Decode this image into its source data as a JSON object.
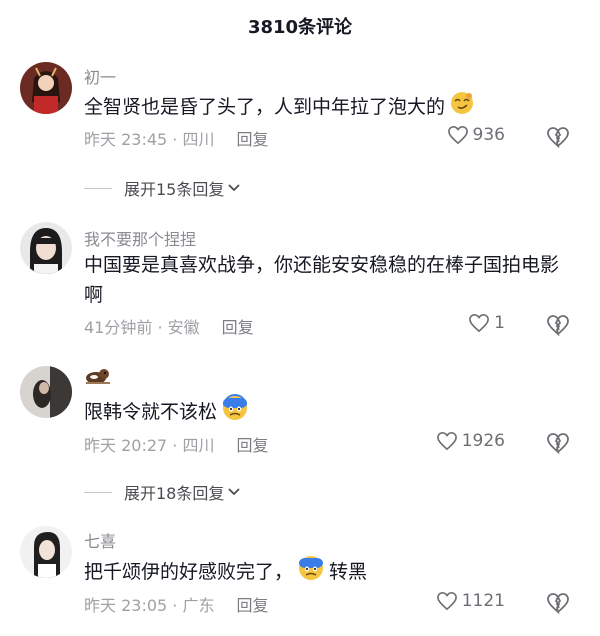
{
  "header": {
    "title": "3810条评论"
  },
  "comments": [
    {
      "username": "初一",
      "text": "全智贤也是昏了头了，人到中年拉了泡大的",
      "time_location": "昨天 23:45 · 四川",
      "reply_label": "回复",
      "likes": "936",
      "expand_label": "展开15条回复"
    },
    {
      "username": "我不要那个捏捏",
      "text": "中国要是真喜欢战争，你还能安安稳稳的在棒子国拍电影啊",
      "time_location": "41分钟前 · 安徽",
      "reply_label": "回复",
      "likes": "1"
    },
    {
      "username": "",
      "text": "限韩令就不该松",
      "time_location": "昨天 20:27 · 四川",
      "reply_label": "回复",
      "likes": "1926",
      "expand_label": "展开18条回复"
    },
    {
      "username": "七喜",
      "text": "把千颂伊的好感败完了，",
      "text_suffix": "转黑",
      "time_location": "昨天 23:05 · 广东",
      "reply_label": "回复",
      "likes": "1121"
    }
  ],
  "icons": {
    "heart": "heart-outline-icon",
    "dislike": "broken-heart-icon",
    "chevron": "chevron-down-icon"
  },
  "colors": {
    "meta": "#a0a1a6",
    "text": "#161823",
    "emoji_blue": "#3b7de8",
    "emoji_yellow": "#f5c542"
  }
}
